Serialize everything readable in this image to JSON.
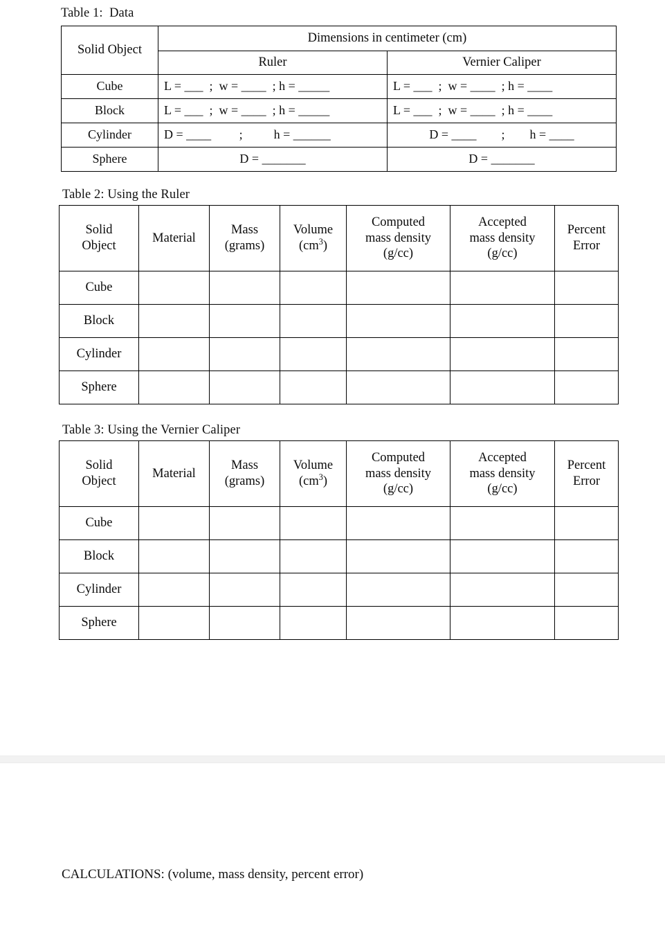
{
  "document": {
    "page_background": "#ffffff",
    "text_color": "#0c0c0c",
    "sheet_break_color": "#f2f2f2"
  },
  "table1": {
    "title": "Table 1:  Data",
    "header": {
      "solid_object": "Solid Object",
      "dimensions": "Dimensions in centimeter (cm)",
      "ruler": "Ruler",
      "vernier_caliper": "Vernier Caliper"
    },
    "rows": [
      {
        "object": "Cube",
        "ruler": "L = ___  ;  w = ____  ; h = _____",
        "vernier": "L = ___  ;  w = ____  ; h = ____"
      },
      {
        "object": "Block",
        "ruler": "L = ___  ;  w = ____  ; h = _____",
        "vernier": "L = ___  ;  w = ____  ; h = ____"
      },
      {
        "object": "Cylinder",
        "ruler": "D = ____         ;          h = ______",
        "vernier": "D = ____        ;        h = ____"
      },
      {
        "object": "Sphere",
        "ruler": "D = _______",
        "vernier": "D = _______"
      }
    ]
  },
  "table2": {
    "title": "Table 2: Using the Ruler",
    "columns": [
      "Solid\nObject",
      "Material",
      "Mass\n(grams)",
      "Volume\n(cm3)",
      "Computed\nmass density\n(g/cc)",
      "Accepted\nmass density\n(g/cc)",
      "Percent\nError"
    ],
    "column_parts": {
      "volume_line1": "Volume",
      "volume_line2_prefix": "(cm",
      "volume_line2_sup": "3",
      "volume_line2_suffix": ")"
    },
    "rows": [
      {
        "object": "Cube",
        "material": "",
        "mass": "",
        "volume": "",
        "computed_density": "",
        "accepted_density": "",
        "percent_error": ""
      },
      {
        "object": "Block",
        "material": "",
        "mass": "",
        "volume": "",
        "computed_density": "",
        "accepted_density": "",
        "percent_error": ""
      },
      {
        "object": "Cylinder",
        "material": "",
        "mass": "",
        "volume": "",
        "computed_density": "",
        "accepted_density": "",
        "percent_error": ""
      },
      {
        "object": "Sphere",
        "material": "",
        "mass": "",
        "volume": "",
        "computed_density": "",
        "accepted_density": "",
        "percent_error": ""
      }
    ]
  },
  "table3": {
    "title": "Table 3: Using the Vernier Caliper",
    "columns": [
      "Solid\nObject",
      "Material",
      "Mass\n(grams)",
      "Volume\n(cm3)",
      "Computed\nmass density\n(g/cc)",
      "Accepted\nmass density\n(g/cc)",
      "Percent\nError"
    ],
    "column_parts": {
      "volume_line1": "Volume",
      "volume_line2_prefix": "(cm",
      "volume_line2_sup": "3",
      "volume_line2_suffix": ")"
    },
    "rows": [
      {
        "object": "Cube",
        "material": "",
        "mass": "",
        "volume": "",
        "computed_density": "",
        "accepted_density": "",
        "percent_error": ""
      },
      {
        "object": "Block",
        "material": "",
        "mass": "",
        "volume": "",
        "computed_density": "",
        "accepted_density": "",
        "percent_error": ""
      },
      {
        "object": "Cylinder",
        "material": "",
        "mass": "",
        "volume": "",
        "computed_density": "",
        "accepted_density": "",
        "percent_error": ""
      },
      {
        "object": "Sphere",
        "material": "",
        "mass": "",
        "volume": "",
        "computed_density": "",
        "accepted_density": "",
        "percent_error": ""
      }
    ]
  },
  "calculations": {
    "heading": "CALCULATIONS: (volume, mass density, percent error)"
  }
}
